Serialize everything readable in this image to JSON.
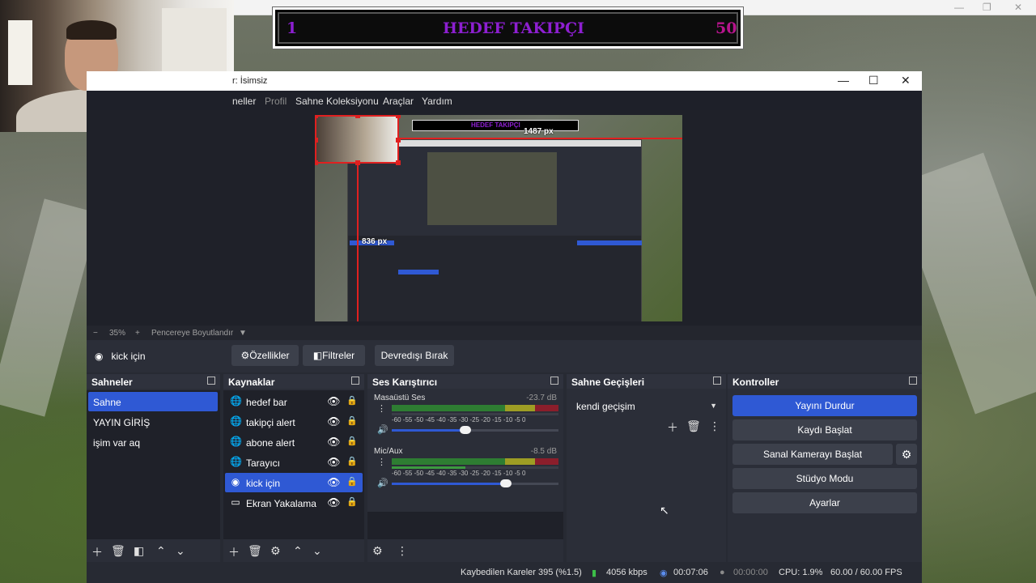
{
  "overlay": {
    "goal_left": "1",
    "goal_title": "HEDEF TAKIPÇI",
    "goal_right": "50"
  },
  "obs": {
    "title": "r: İsimsiz",
    "menu": [
      "neller",
      "Profil",
      "Sahne Koleksiyonu",
      "Araçlar",
      "Yardım"
    ],
    "preview": {
      "guide_w": "1487 px",
      "guide_h": "836 px",
      "nested_goal": "HEDEF TAKIPÇI"
    },
    "zoom": {
      "minus": "−",
      "value": "35%",
      "plus": "+",
      "fit": "Pencereye Boyutlandır"
    },
    "context": {
      "source": "kick için",
      "properties": "Özellikler",
      "filters": "Filtreler",
      "deactivate": "Devredışı Bırak"
    },
    "docks": {
      "scenes": {
        "title": "Sahneler",
        "items": [
          "Sahne",
          "YAYIN GİRİŞ",
          "işim var aq"
        ],
        "selected": "Sahne"
      },
      "sources": {
        "title": "Kaynaklar",
        "items": [
          "hedef bar",
          "takipçi alert",
          "abone alert",
          "Tarayıcı",
          "kick için",
          "Ekran Yakalama"
        ],
        "selected": "kick için"
      },
      "mixer": {
        "title": "Ses Karıştırıcı",
        "scale": "-60 -55 -50 -45 -40 -35 -30 -25 -20 -15 -10 -5 0",
        "tracks": [
          {
            "name": "Masaüstü Ses",
            "db": "-23.7 dB",
            "level": 0.52
          },
          {
            "name": "Mic/Aux",
            "db": "-8.5 dB",
            "level": 0.72
          }
        ]
      },
      "transitions": {
        "title": "Sahne Geçişleri",
        "selected": "kendi geçişim"
      },
      "controls": {
        "title": "Kontroller",
        "stop_stream": "Yayını Durdur",
        "start_recording": "Kaydı Başlat",
        "virtual_cam": "Sanal Kamerayı Başlat",
        "studio_mode": "Stüdyo Modu",
        "settings": "Ayarlar"
      }
    },
    "status": {
      "dropped": "Kaybedilen Kareler 395 (%1.5)",
      "bitrate": "4056 kbps",
      "stream_time": "00:07:06",
      "rec_time": "00:00:00",
      "cpu": "CPU: 1.9%",
      "fps": "60.00 / 60.00 FPS"
    }
  },
  "colors": {
    "accent": "#2f59d4",
    "goal_text": "#8d1fd1",
    "obs_bg": "#272a33"
  }
}
